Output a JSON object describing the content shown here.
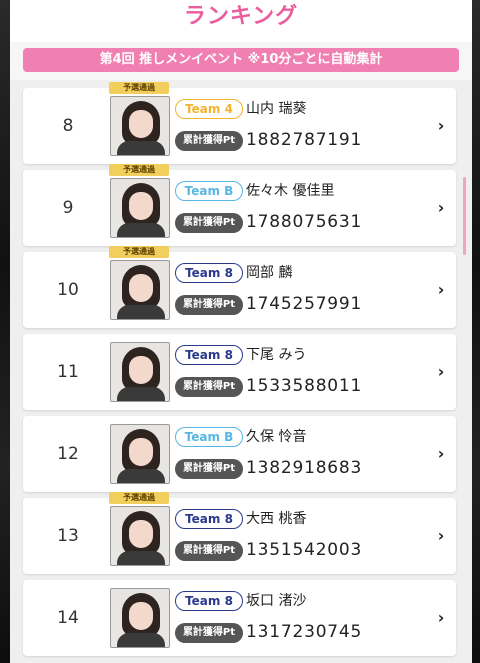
{
  "header": {
    "title": "ランキング",
    "banner": "第4回 推しメンイベント ※10分ごとに自動集計"
  },
  "labels": {
    "qualified": "予選通過",
    "points_label": "累計獲得Pt",
    "chevron": "›"
  },
  "team_colors": {
    "Team 4": "#f3b32c",
    "Team B": "#57b6e3",
    "Team 8": "#2b3a8c"
  },
  "rows": [
    {
      "rank": "8",
      "team": "Team 4",
      "name": "山内 瑞葵",
      "points": "1882787191",
      "qualified": true
    },
    {
      "rank": "9",
      "team": "Team B",
      "name": "佐々木 優佳里",
      "points": "1788075631",
      "qualified": true
    },
    {
      "rank": "10",
      "team": "Team 8",
      "name": "岡部 麟",
      "points": "1745257991",
      "qualified": true
    },
    {
      "rank": "11",
      "team": "Team 8",
      "name": "下尾 みう",
      "points": "1533588011",
      "qualified": false
    },
    {
      "rank": "12",
      "team": "Team B",
      "name": "久保 怜音",
      "points": "1382918683",
      "qualified": false
    },
    {
      "rank": "13",
      "team": "Team 8",
      "name": "大西 桃香",
      "points": "1351542003",
      "qualified": true
    },
    {
      "rank": "14",
      "team": "Team 8",
      "name": "坂口 渚沙",
      "points": "1317230745",
      "qualified": false
    }
  ]
}
